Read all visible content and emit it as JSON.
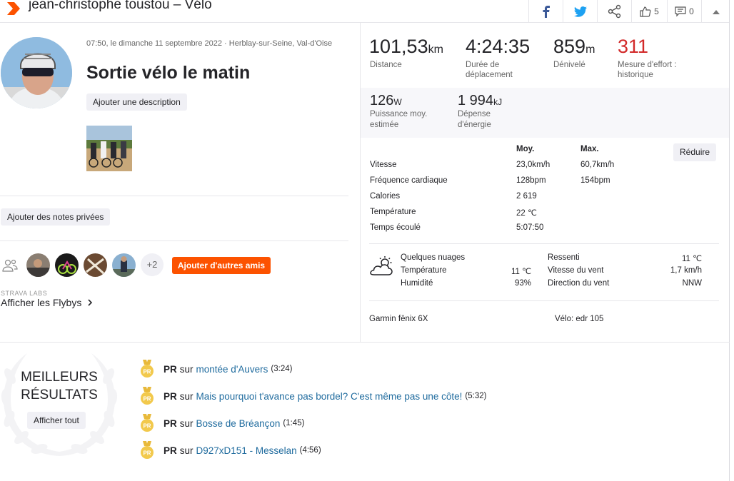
{
  "header": {
    "title": "jean-christophe toustou – Vélo",
    "kudos_count": "5",
    "comments_count": "0",
    "icons": [
      "strava-chevron-icon",
      "facebook-icon",
      "twitter-icon",
      "share-icon",
      "thumbs-up-icon",
      "comment-icon",
      "collapse-up-icon"
    ]
  },
  "activity": {
    "dateline": "07:50, le dimanche 11 septembre 2022 · Herblay-sur-Seine, Val-d'Oise",
    "title": "Sortie vélo le matin",
    "add_description": "Ajouter une description",
    "add_private_notes": "Ajouter des notes privées",
    "friends_more": "+2",
    "add_friends": "Ajouter d'autres amis",
    "labs_label": "STRAVA LABS",
    "flybys": "Afficher les Flybys"
  },
  "stats": {
    "distance": {
      "value": "101,53",
      "unit": "km",
      "label": "Distance"
    },
    "moving_time": {
      "value": "4:24:35",
      "label": "Durée de déplacement"
    },
    "elevation": {
      "value": "859",
      "unit": "m",
      "label": "Dénivelé"
    },
    "effort": {
      "value": "311",
      "label": "Mesure d'effort : historique",
      "color": "#d22929"
    },
    "power": {
      "value": "126",
      "unit": "W",
      "label": "Puissance moy. estimée"
    },
    "energy": {
      "value": "1 994",
      "unit": "kJ",
      "label": "Dépense d'énergie"
    }
  },
  "details_table": {
    "headers": {
      "avg": "Moy.",
      "max": "Max."
    },
    "collapse": "Réduire",
    "rows": [
      {
        "label": "Vitesse",
        "avg": "23,0km/h",
        "max": "60,7km/h"
      },
      {
        "label": "Fréquence cardiaque",
        "avg": "128bpm",
        "max": "154bpm"
      },
      {
        "label": "Calories",
        "avg": "2 619",
        "max": ""
      },
      {
        "label": "Température",
        "avg": "22 ℃",
        "max": ""
      },
      {
        "label": "Temps écoulé",
        "avg": "5:07:50",
        "max": ""
      }
    ]
  },
  "weather": {
    "condition": "Quelques nuages",
    "temperature_label": "Température",
    "temperature": "11 ℃",
    "humidity_label": "Humidité",
    "humidity": "93%",
    "feels_like_label": "Ressenti",
    "feels_like": "11 ℃",
    "wind_speed_label": "Vitesse du vent",
    "wind_speed": "1,7 km/h",
    "wind_dir_label": "Direction du vent",
    "wind_dir": "NNW"
  },
  "equipment": {
    "device": "Garmin fēnix 6X",
    "bike": "Vélo: edr 105"
  },
  "best_results": {
    "title_line1": "MEILLEURS",
    "title_line2": "RÉSULTATS",
    "show_all": "Afficher tout",
    "items": [
      {
        "badge": "PR",
        "sur": "sur",
        "segment": "montée d'Auvers",
        "time": "(3:24)"
      },
      {
        "badge": "PR",
        "sur": "sur",
        "segment": "Mais pourquoi t'avance pas bordel? C'est même pas une côte!",
        "time": "(5:32)"
      },
      {
        "badge": "PR",
        "sur": "sur",
        "segment": "Bosse de Bréançon",
        "time": "(1:45)"
      },
      {
        "badge": "PR",
        "sur": "sur",
        "segment": "D927xD151 - Messelan",
        "time": "(4:56)"
      }
    ]
  },
  "colors": {
    "accent": "#fc5200",
    "link": "#1f6b9e",
    "medal": "#f2c94c"
  }
}
